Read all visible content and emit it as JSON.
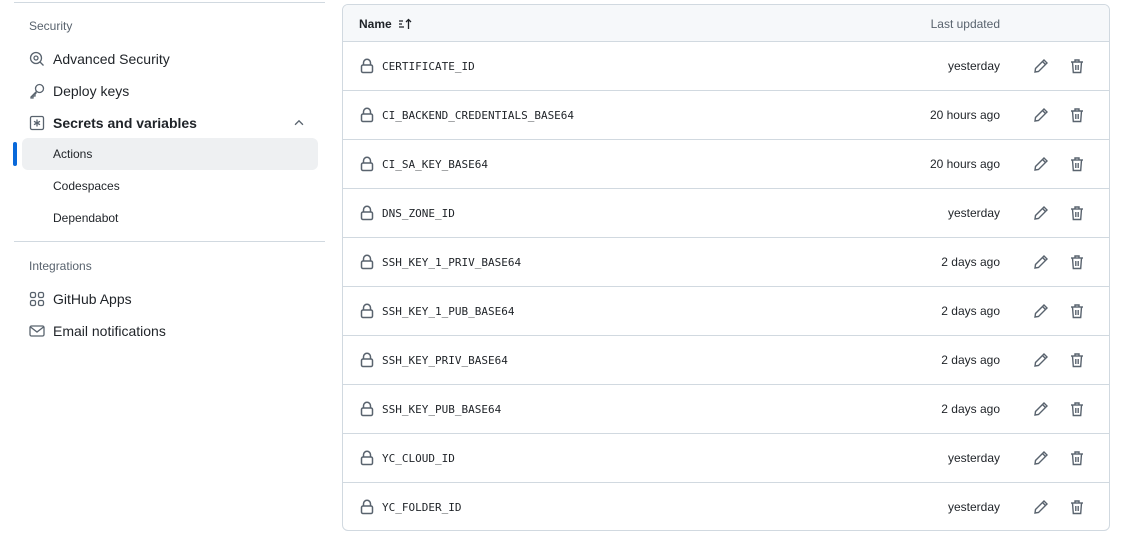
{
  "sidebar": {
    "security_heading": "Security",
    "security_items": [
      {
        "label": "Advanced Security",
        "icon": "codescan-icon"
      },
      {
        "label": "Deploy keys",
        "icon": "key-icon"
      },
      {
        "label": "Secrets and variables",
        "icon": "asterisk-box-icon",
        "expanded": true
      }
    ],
    "sub_items": [
      {
        "label": "Actions",
        "active": true
      },
      {
        "label": "Codespaces",
        "active": false
      },
      {
        "label": "Dependabot",
        "active": false
      }
    ],
    "integrations_heading": "Integrations",
    "integration_items": [
      {
        "label": "GitHub Apps",
        "icon": "apps-icon"
      },
      {
        "label": "Email notifications",
        "icon": "mail-icon"
      }
    ]
  },
  "table": {
    "col_name": "Name",
    "col_updated": "Last updated",
    "rows": [
      {
        "name": "CERTIFICATE_ID",
        "updated": "yesterday"
      },
      {
        "name": "CI_BACKEND_CREDENTIALS_BASE64",
        "updated": "20 hours ago"
      },
      {
        "name": "CI_SA_KEY_BASE64",
        "updated": "20 hours ago"
      },
      {
        "name": "DNS_ZONE_ID",
        "updated": "yesterday"
      },
      {
        "name": "SSH_KEY_1_PRIV_BASE64",
        "updated": "2 days ago"
      },
      {
        "name": "SSH_KEY_1_PUB_BASE64",
        "updated": "2 days ago"
      },
      {
        "name": "SSH_KEY_PRIV_BASE64",
        "updated": "2 days ago"
      },
      {
        "name": "SSH_KEY_PUB_BASE64",
        "updated": "2 days ago"
      },
      {
        "name": "YC_CLOUD_ID",
        "updated": "yesterday"
      },
      {
        "name": "YC_FOLDER_ID",
        "updated": "yesterday"
      }
    ]
  },
  "colors": {
    "accent": "#0969da",
    "border": "#d1d9e0",
    "active_bg": "#eef0f2",
    "muted": "#59636e"
  }
}
